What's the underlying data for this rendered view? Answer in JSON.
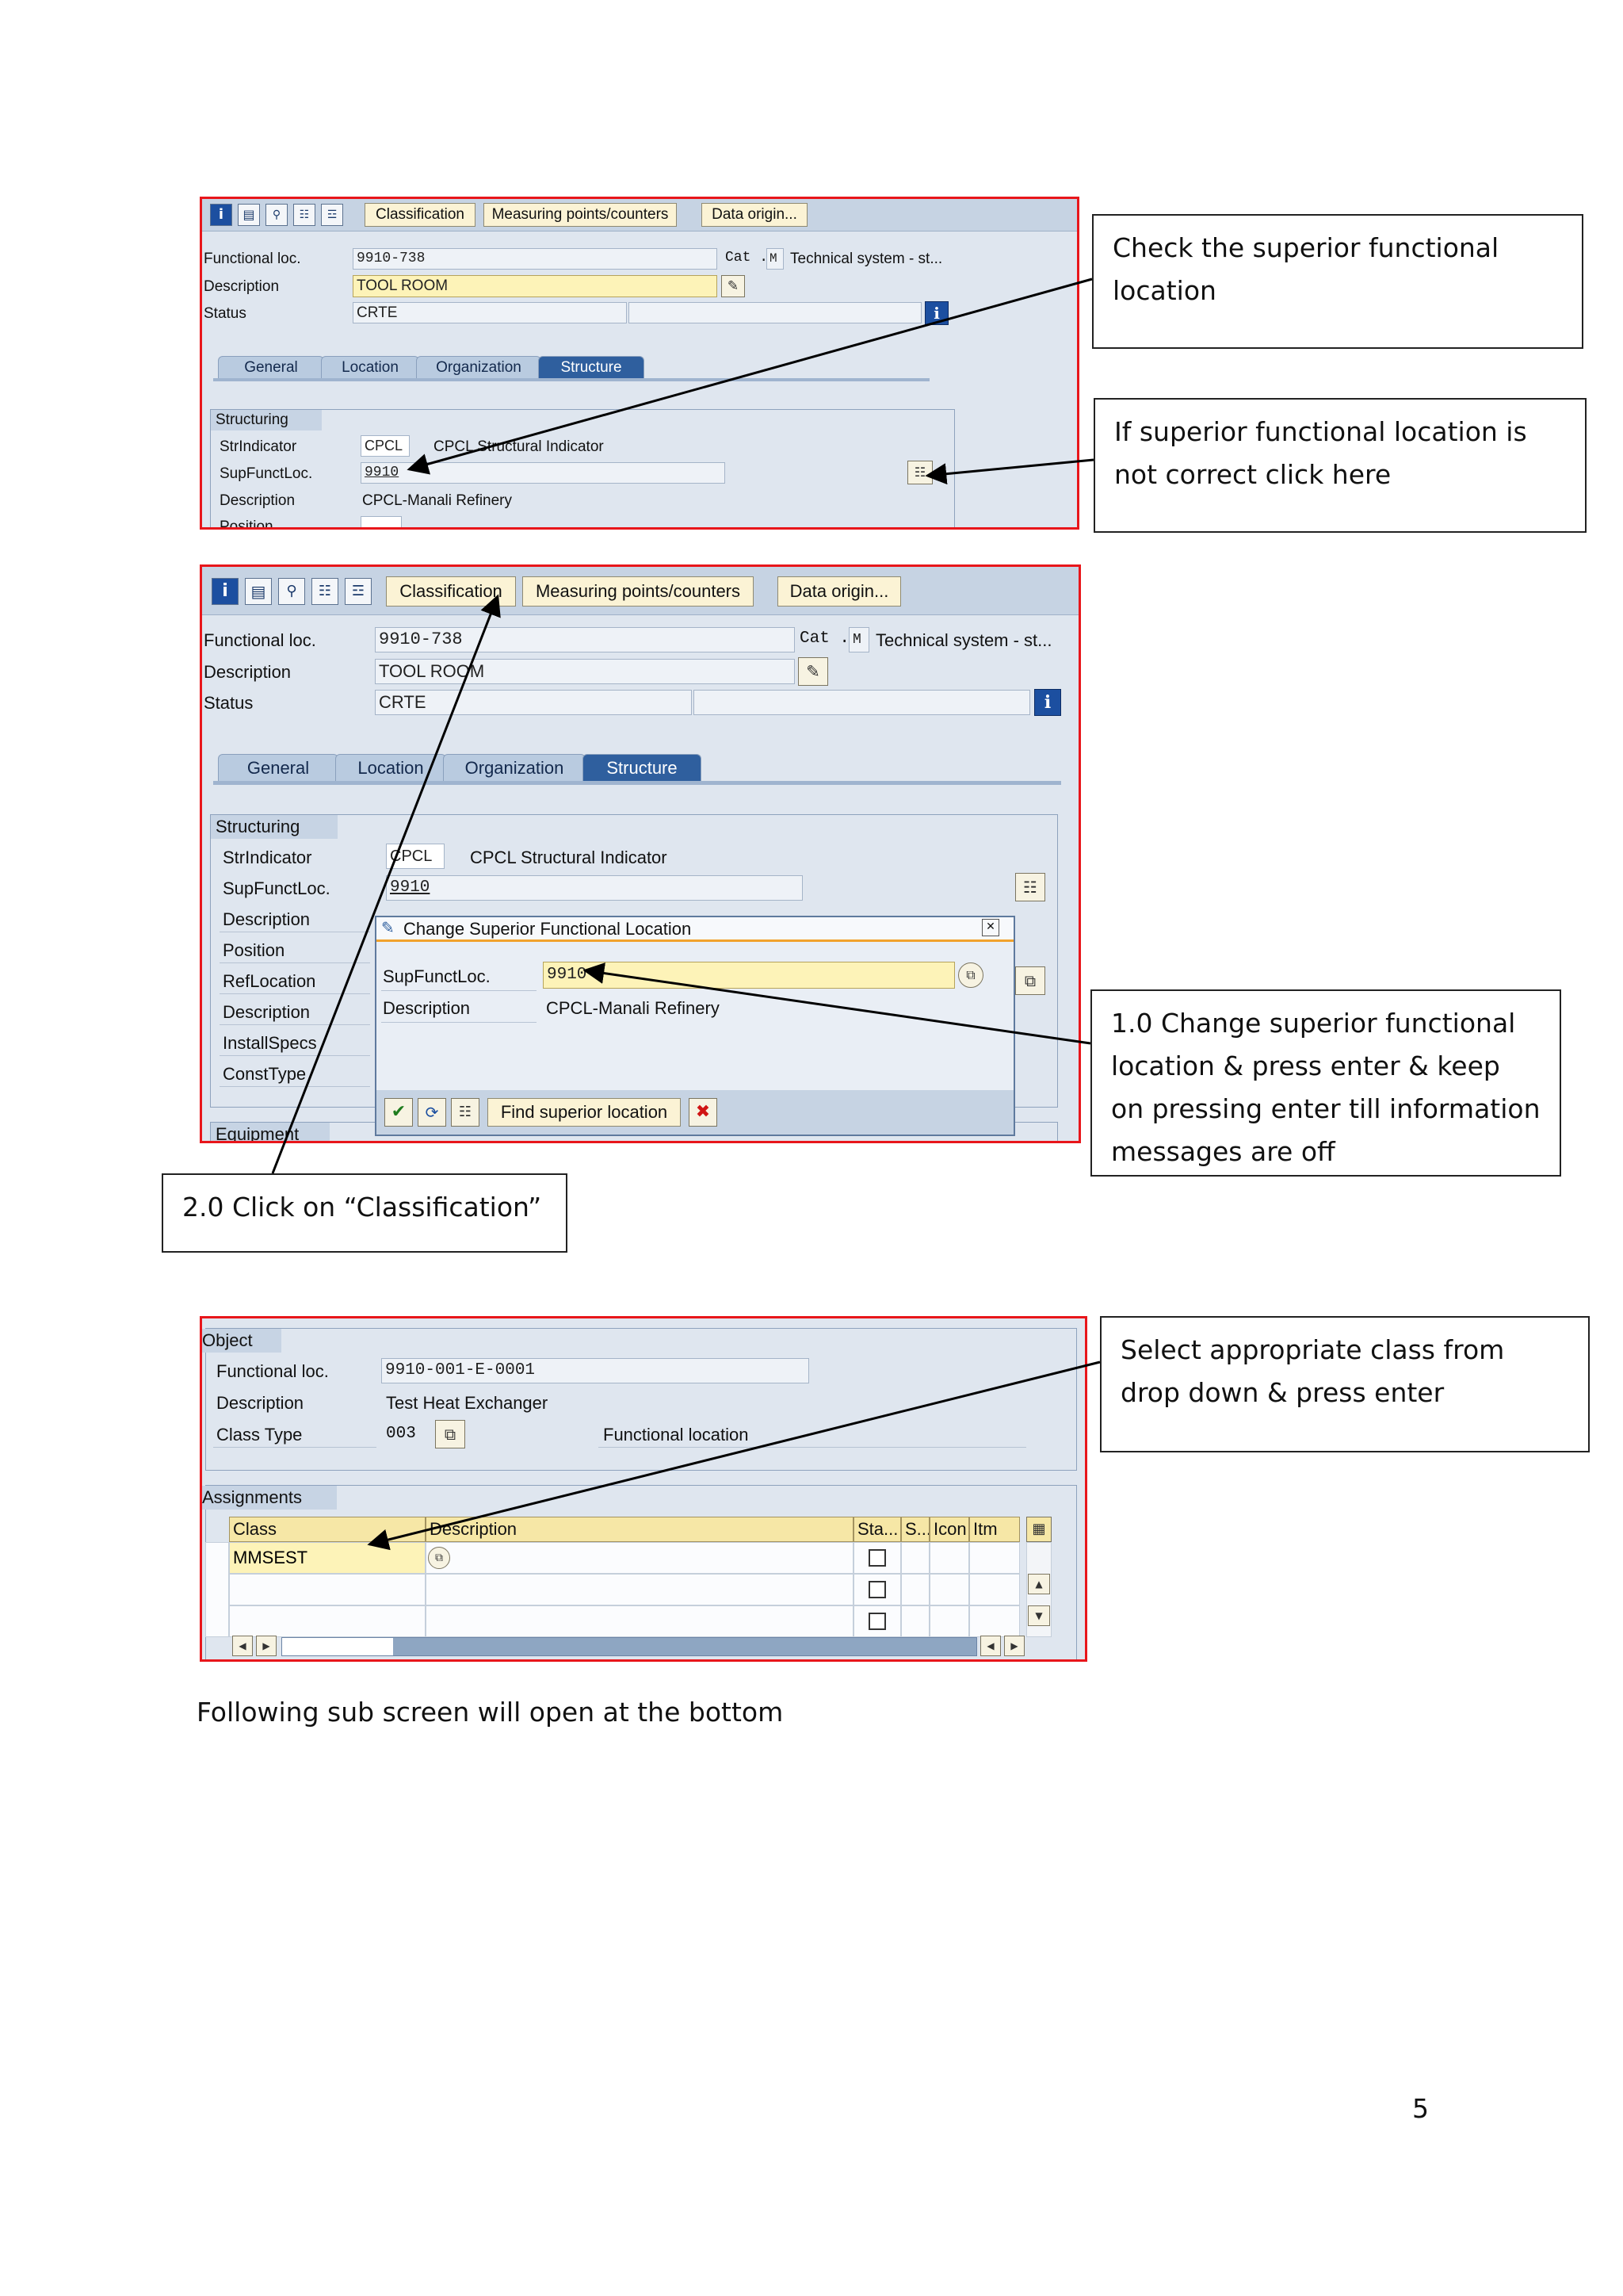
{
  "toolbar": {
    "classification": "Classification",
    "measuring": "Measuring points/counters",
    "data_origin": "Data origin..."
  },
  "labels": {
    "functional_loc": "Functional loc.",
    "description": "Description",
    "status": "Status",
    "cat": "Cat .",
    "cat_code": "M",
    "cat_text": "Technical system - st...",
    "structuring": "Structuring",
    "strindicator": "StrIndicator",
    "supfunctloc": "SupFunctLoc.",
    "position": "Position",
    "reflocation": "RefLocation",
    "installspecs": "InstallSpecs",
    "consttype": "ConstType",
    "equipment": "Equipment"
  },
  "tabs": [
    "General",
    "Location",
    "Organization",
    "Structure"
  ],
  "screen1": {
    "functional_loc": "9910-738",
    "description": "TOOL ROOM",
    "status": "CRTE",
    "str_code": "CPCL",
    "str_text": "CPCL Structural Indicator",
    "supfunctloc": "9910",
    "sup_desc": "CPCL-Manali Refinery",
    "position_cut": "Position"
  },
  "screen2": {
    "functional_loc": "9910-738",
    "description": "TOOL ROOM",
    "status": "CRTE",
    "str_code": "CPCL",
    "str_text": "CPCL Structural Indicator",
    "supfunctloc": "9910",
    "hidden_desc": "CPCL-Manali Refinery"
  },
  "dialog": {
    "title": "Change Superior Functional Location",
    "sup_label": "SupFunctLoc.",
    "sup_value": "9910",
    "desc_label": "Description",
    "desc_value": "CPCL-Manali Refinery",
    "find_btn": "Find superior location"
  },
  "screen3": {
    "object_title": "Object",
    "functional_loc_label": "Functional loc.",
    "functional_loc": "9910-001-E-0001",
    "description_label": "Description",
    "description": "Test Heat Exchanger",
    "class_type_label": "Class Type",
    "class_type": "003",
    "class_type_text": "Functional location",
    "assignments_title": "Assignments",
    "columns": [
      "Class",
      "Description",
      "Sta...",
      "S...",
      "Icon",
      "Itm"
    ],
    "class_value": "MMSEST"
  },
  "callouts": {
    "check_superior": "Check the superior functional location",
    "if_not_correct": "If  superior functional location is not correct click here",
    "change_superior": "1.0 Change superior functional location & press enter & keep on pressing enter till information messages are off",
    "click_classification": "2.0 Click on “Classification”",
    "select_class": "Select appropriate class from drop down & press enter"
  },
  "footer": {
    "caption": "Following sub screen will open at the bottom",
    "page_number": "5"
  }
}
